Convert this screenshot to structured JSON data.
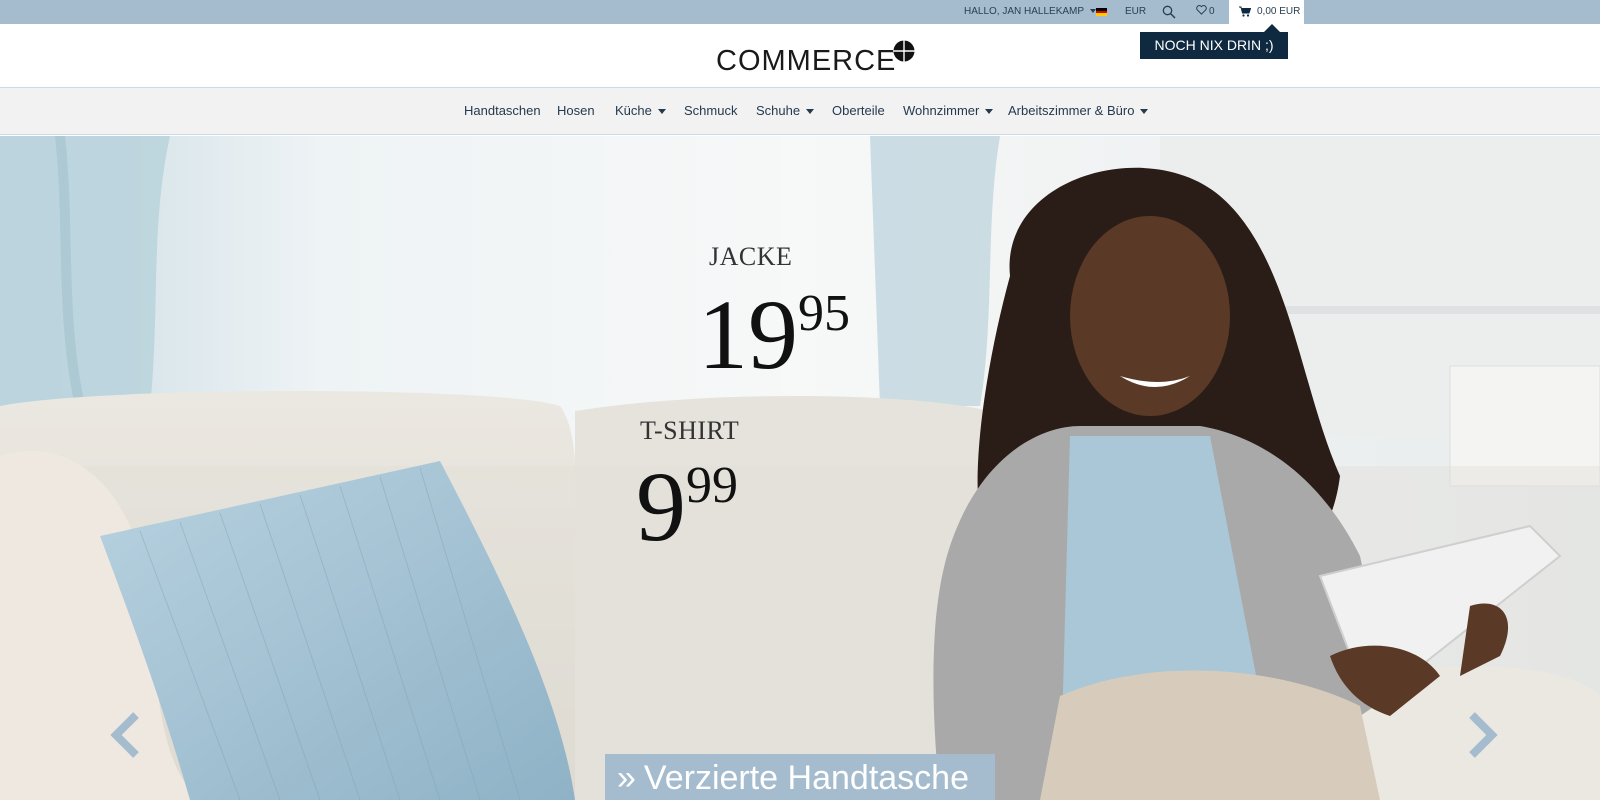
{
  "topbar": {
    "greeting": "HALLO, JAN HALLEKAMP",
    "currency": "EUR",
    "wishlist_count": "0",
    "cart_total": "0,00 EUR",
    "cart_popup": "NOCH NIX DRIN ;)",
    "flag_colors": [
      "#000000",
      "#dd0000",
      "#ffce00"
    ]
  },
  "logo": {
    "text": "COMMERCE"
  },
  "nav": {
    "items": [
      {
        "label": "Handtaschen"
      },
      {
        "label": "Hosen"
      },
      {
        "label": "Küche"
      },
      {
        "label": "Schmuck"
      },
      {
        "label": "Schuhe"
      },
      {
        "label": "Oberteile"
      },
      {
        "label": "Wohnzimmer"
      },
      {
        "label": "Arbeitszimmer & Büro"
      }
    ]
  },
  "hero": {
    "jacke_label": "JACKE",
    "jacke_price_main": "19",
    "jacke_price_cents": "95",
    "tshirt_label": "T-SHIRT",
    "tshirt_price_main": "9",
    "tshirt_price_cents": "99",
    "cta_label": "Verzierte Handtasche"
  },
  "colors": {
    "topbar": "#a4bccd",
    "nav_text": "#253a4e",
    "popup": "#0f2a40"
  }
}
